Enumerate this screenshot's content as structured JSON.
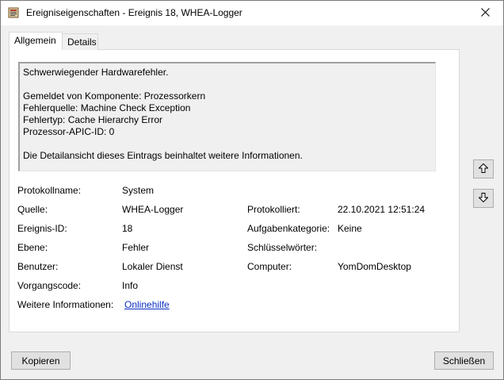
{
  "window": {
    "title": "Ereigniseigenschaften - Ereignis 18, WHEA-Logger"
  },
  "tabs": [
    {
      "label": "Allgemein"
    },
    {
      "label": "Details"
    }
  ],
  "description": {
    "lines": [
      "Schwerwiegender Hardwarefehler.",
      "",
      "Gemeldet von Komponente: Prozessorkern",
      "Fehlerquelle: Machine Check Exception",
      "Fehlertyp: Cache Hierarchy Error",
      "Prozessor-APIC-ID: 0",
      "",
      "Die Detailansicht dieses Eintrags beinhaltet weitere Informationen."
    ]
  },
  "fields": {
    "protokollname": {
      "label": "Protokollname:",
      "value": "System"
    },
    "quelle": {
      "label": "Quelle:",
      "value": "WHEA-Logger"
    },
    "protokolliert": {
      "label": "Protokolliert:",
      "value": "22.10.2021 12:51:24"
    },
    "ereignis_id": {
      "label": "Ereignis-ID:",
      "value": "18"
    },
    "aufgabenkategorie": {
      "label": "Aufgabenkategorie:",
      "value": "Keine"
    },
    "ebene": {
      "label": "Ebene:",
      "value": "Fehler"
    },
    "schluesselwoerter": {
      "label": "Schlüsselwörter:",
      "value": ""
    },
    "benutzer": {
      "label": "Benutzer:",
      "value": "Lokaler Dienst"
    },
    "computer": {
      "label": "Computer:",
      "value": "YomDomDesktop"
    },
    "vorgangscode": {
      "label": "Vorgangscode:",
      "value": "Info"
    },
    "weitere_informationen": {
      "label": "Weitere Informationen:",
      "value": "Onlinehilfe"
    }
  },
  "buttons": {
    "copy": "Kopieren",
    "close": "Schließen"
  },
  "icons": {
    "app": "event-properties-icon",
    "close": "close-icon",
    "up": "arrow-up-icon",
    "down": "arrow-down-icon"
  }
}
